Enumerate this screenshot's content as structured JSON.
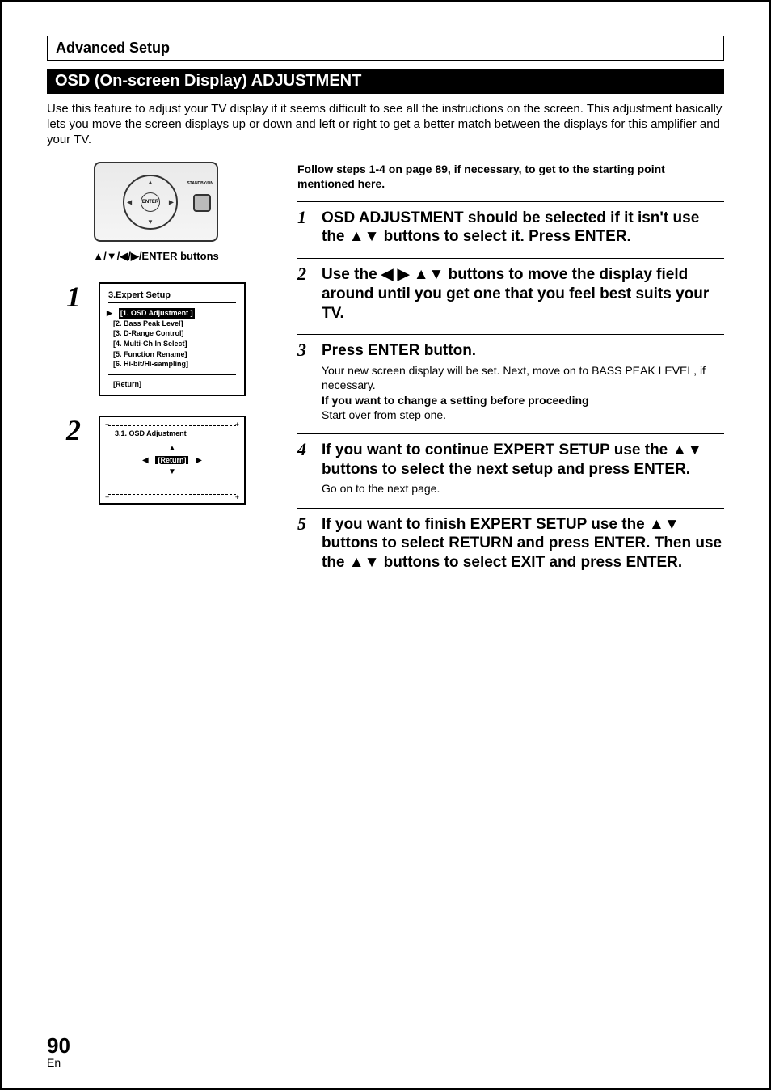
{
  "header": {
    "breadcrumb": "Advanced Setup"
  },
  "section": {
    "title": "OSD (On-screen Display) ADJUSTMENT"
  },
  "intro": "Use this feature to adjust your TV display if it seems difficult to see all the instructions on the screen. This adjustment basically lets you move the screen displays up or down and left or right to get a better match between the displays for this amplifier and your TV.",
  "left": {
    "remote_caption": "▲/▼/◀/▶/ENTER buttons",
    "remote_enter": "ENTER",
    "remote_standby": "STANDBY/ON",
    "step1_num": "1",
    "osd1": {
      "title": "3.Expert Setup",
      "items": [
        "[1. OSD Adjustment ]",
        "[2. Bass Peak Level]",
        "[3. D-Range Control]",
        "[4. Multi-Ch In Select]",
        "[5. Function Rename]",
        "[6. Hi-bit/Hi-sampling]"
      ],
      "return_label": "[Return]"
    },
    "step2_num": "2",
    "osd2": {
      "title": "3.1. OSD  Adjustment",
      "center_label": "[Return]"
    }
  },
  "right": {
    "pre_note": "Follow steps 1-4 on page 89, if necessary, to get to the starting point mentioned here.",
    "steps": [
      {
        "num": "1",
        "title": "OSD ADJUSTMENT should be selected if it isn't use the ▲▼ buttons to select it. Press ENTER."
      },
      {
        "num": "2",
        "title": " Use the ◀ ▶ ▲▼ buttons to move the display field around until you get one that you feel best suits your TV."
      },
      {
        "num": "3",
        "title": "Press ENTER button.",
        "body_plain": "Your new screen display will be set. Next, move on to BASS PEAK LEVEL,  if necessary.",
        "body_bold": "If you want to change a setting before proceeding",
        "body_plain2": "Start over from step one."
      },
      {
        "num": "4",
        "title": "If you want to continue EXPERT SETUP use the ▲▼ buttons to select the next setup and press ENTER.",
        "body_plain": "Go on to the next page."
      },
      {
        "num": "5",
        "title": "If you want to finish EXPERT SETUP use the ▲▼ buttons to select RETURN and press ENTER. Then use the ▲▼ buttons to select EXIT and press ENTER."
      }
    ]
  },
  "footer": {
    "page_number": "90",
    "lang": "En"
  }
}
